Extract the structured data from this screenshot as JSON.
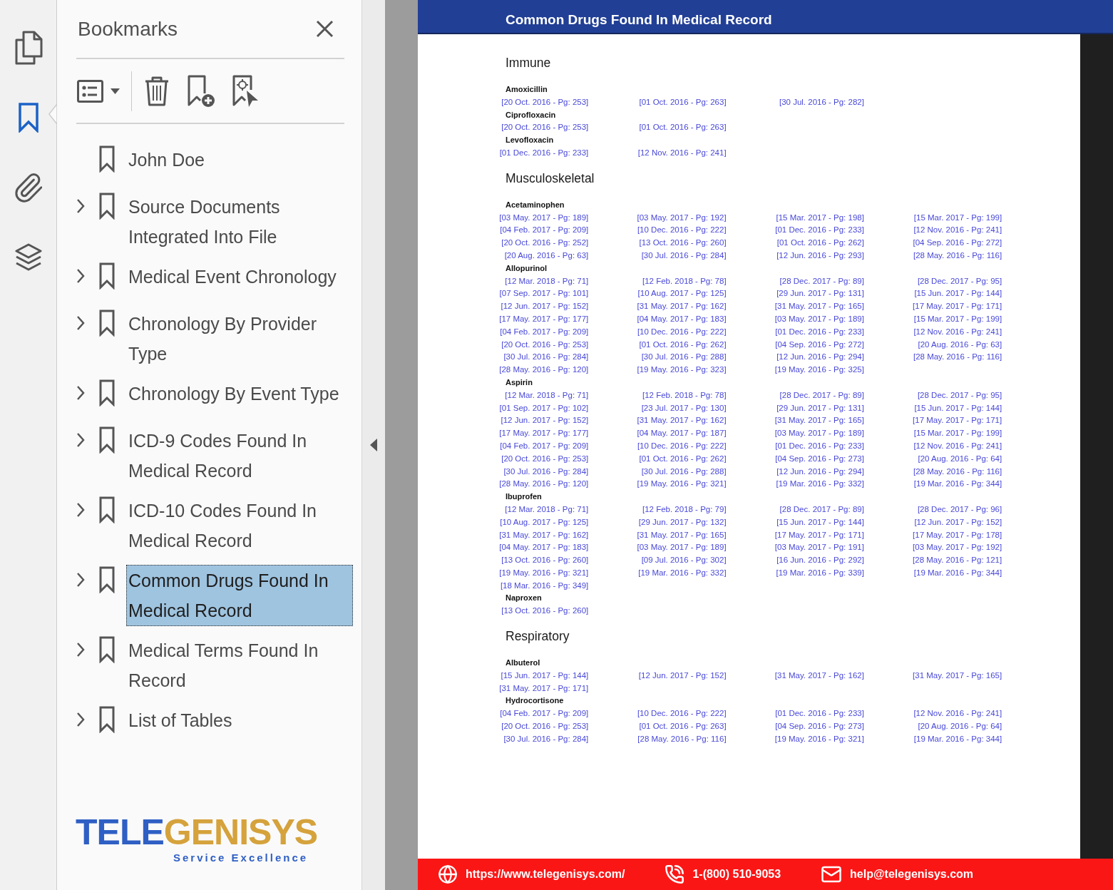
{
  "left_rail": {
    "items": [
      {
        "kind": "pages",
        "selected": false
      },
      {
        "kind": "bookmarks",
        "selected": true
      },
      {
        "kind": "attachments",
        "selected": false
      },
      {
        "kind": "layers",
        "selected": false
      }
    ]
  },
  "bookmarks_panel": {
    "title": "Bookmarks",
    "items": [
      {
        "label": "John Doe",
        "expandable": false,
        "selected": false
      },
      {
        "label": "Source Documents Integrated Into File",
        "expandable": true,
        "expanded": false,
        "selected": false
      },
      {
        "label": "Medical Event Chronology",
        "expandable": true,
        "expanded": false,
        "selected": false
      },
      {
        "label": "Chronology By Provider Type",
        "expandable": true,
        "expanded": false,
        "selected": false
      },
      {
        "label": "Chronology By Event Type",
        "expandable": true,
        "expanded": false,
        "selected": false
      },
      {
        "label": "ICD-9 Codes Found In Medical Record",
        "expandable": true,
        "expanded": false,
        "selected": false
      },
      {
        "label": "ICD-10 Codes Found In Medical Record",
        "expandable": true,
        "expanded": false,
        "selected": false
      },
      {
        "label": "Common Drugs Found In Medical Record",
        "expandable": true,
        "expanded": false,
        "selected": true
      },
      {
        "label": "Medical Terms Found In Record",
        "expandable": true,
        "expanded": false,
        "selected": false
      },
      {
        "label": "List of Tables",
        "expandable": true,
        "expanded": false,
        "selected": false
      }
    ]
  },
  "logo": {
    "wordmark_left": "TELE",
    "wordmark_right": "GENISYS",
    "tagline": "Service Excellence"
  },
  "document": {
    "title": "Common Drugs Found In Medical Record",
    "sections": [
      {
        "title": "Immune",
        "drugs": [
          {
            "name": "Amoxicillin",
            "references": [
              "[20 Oct. 2016 - Pg: 253]",
              "[01 Oct. 2016 - Pg: 263]",
              "[30 Jul. 2016 - Pg: 282]"
            ]
          },
          {
            "name": "Ciprofloxacin",
            "references": [
              "[20 Oct. 2016 - Pg: 253]",
              "[01 Oct. 2016 - Pg: 263]"
            ]
          },
          {
            "name": "Levofloxacin",
            "references": [
              "[01 Dec. 2016 - Pg: 233]",
              "[12 Nov. 2016 - Pg: 241]"
            ]
          }
        ]
      },
      {
        "title": "Musculoskeletal",
        "drugs": [
          {
            "name": "Acetaminophen",
            "references": [
              "[03 May. 2017 - Pg: 189]",
              "[03 May. 2017 - Pg: 192]",
              "[15 Mar. 2017 - Pg: 198]",
              "[15 Mar. 2017 - Pg: 199]",
              "[04 Feb. 2017 - Pg: 209]",
              "[10 Dec. 2016 - Pg: 222]",
              "[01 Dec. 2016 - Pg: 233]",
              "[12 Nov. 2016 - Pg: 241]",
              "[20 Oct. 2016 - Pg: 252]",
              "[13 Oct. 2016 - Pg: 260]",
              "[01 Oct. 2016 - Pg: 262]",
              "[04 Sep. 2016 - Pg: 272]",
              "[20 Aug. 2016 - Pg: 63]",
              "[30 Jul. 2016 - Pg: 284]",
              "[12 Jun. 2016 - Pg: 293]",
              "[28 May. 2016 - Pg: 116]"
            ]
          },
          {
            "name": "Allopurinol",
            "references": [
              "[12 Mar. 2018 - Pg: 71]",
              "[12 Feb. 2018 - Pg: 78]",
              "[28 Dec. 2017 - Pg: 89]",
              "[28 Dec. 2017 - Pg: 95]",
              "[07 Sep. 2017 - Pg: 101]",
              "[10 Aug. 2017 - Pg: 125]",
              "[29 Jun. 2017 - Pg: 131]",
              "[15 Jun. 2017 - Pg: 144]",
              "[12 Jun. 2017 - Pg: 152]",
              "[31 May. 2017 - Pg: 162]",
              "[31 May. 2017 - Pg: 165]",
              "[17 May. 2017 - Pg: 171]",
              "[17 May. 2017 - Pg: 177]",
              "[04 May. 2017 - Pg: 183]",
              "[03 May. 2017 - Pg: 189]",
              "[15 Mar. 2017 - Pg: 199]",
              "[04 Feb. 2017 - Pg: 209]",
              "[10 Dec. 2016 - Pg: 222]",
              "[01 Dec. 2016 - Pg: 233]",
              "[12 Nov. 2016 - Pg: 241]",
              "[20 Oct. 2016 - Pg: 253]",
              "[01 Oct. 2016 - Pg: 262]",
              "[04 Sep. 2016 - Pg: 272]",
              "[20 Aug. 2016 - Pg: 63]",
              "[30 Jul. 2016 - Pg: 284]",
              "[30 Jul. 2016 - Pg: 288]",
              "[12 Jun. 2016 - Pg: 294]",
              "[28 May. 2016 - Pg: 116]",
              "[28 May. 2016 - Pg: 120]",
              "[19 May. 2016 - Pg: 323]",
              "[19 May. 2016 - Pg: 325]"
            ]
          },
          {
            "name": "Aspirin",
            "references": [
              "[12 Mar. 2018 - Pg: 71]",
              "[12 Feb. 2018 - Pg: 78]",
              "[28 Dec. 2017 - Pg: 89]",
              "[28 Dec. 2017 - Pg: 95]",
              "[01 Sep. 2017 - Pg: 102]",
              "[23 Jul. 2017 - Pg: 130]",
              "[29 Jun. 2017 - Pg: 131]",
              "[15 Jun. 2017 - Pg: 144]",
              "[12 Jun. 2017 - Pg: 152]",
              "[31 May. 2017 - Pg: 162]",
              "[31 May. 2017 - Pg: 165]",
              "[17 May. 2017 - Pg: 171]",
              "[17 May. 2017 - Pg: 177]",
              "[04 May. 2017 - Pg: 187]",
              "[03 May. 2017 - Pg: 189]",
              "[15 Mar. 2017 - Pg: 199]",
              "[04 Feb. 2017 - Pg: 209]",
              "[10 Dec. 2016 - Pg: 222]",
              "[01 Dec. 2016 - Pg: 233]",
              "[12 Nov. 2016 - Pg: 241]",
              "[20 Oct. 2016 - Pg: 253]",
              "[01 Oct. 2016 - Pg: 262]",
              "[04 Sep. 2016 - Pg: 273]",
              "[20 Aug. 2016 - Pg: 64]",
              "[30 Jul. 2016 - Pg: 284]",
              "[30 Jul. 2016 - Pg: 288]",
              "[12 Jun. 2016 - Pg: 294]",
              "[28 May. 2016 - Pg: 116]",
              "[28 May. 2016 - Pg: 120]",
              "[19 May. 2016 - Pg: 321]",
              "[19 Mar. 2016 - Pg: 332]",
              "[19 Mar. 2016 - Pg: 344]"
            ]
          },
          {
            "name": "Ibuprofen",
            "references": [
              "[12 Mar. 2018 - Pg: 71]",
              "[12 Feb. 2018 - Pg: 79]",
              "[28 Dec. 2017 - Pg: 89]",
              "[28 Dec. 2017 - Pg: 96]",
              "[10 Aug. 2017 - Pg: 125]",
              "[29 Jun. 2017 - Pg: 132]",
              "[15 Jun. 2017 - Pg: 144]",
              "[12 Jun. 2017 - Pg: 152]",
              "[31 May. 2017 - Pg: 162]",
              "[31 May. 2017 - Pg: 165]",
              "[17 May. 2017 - Pg: 171]",
              "[17 May. 2017 - Pg: 178]",
              "[04 May. 2017 - Pg: 183]",
              "[03 May. 2017 - Pg: 189]",
              "[03 May. 2017 - Pg: 191]",
              "[03 May. 2017 - Pg: 192]",
              "[13 Oct. 2016 - Pg: 260]",
              "[09 Jul. 2016 - Pg: 302]",
              "[16 Jun. 2016 - Pg: 292]",
              "[28 May. 2016 - Pg: 121]",
              "[19 May. 2016 - Pg: 321]",
              "[19 Mar. 2016 - Pg: 332]",
              "[19 Mar. 2016 - Pg: 339]",
              "[19 Mar. 2016 - Pg: 344]",
              "[18 Mar. 2016 - Pg: 349]"
            ]
          },
          {
            "name": "Naproxen",
            "references": [
              "[13 Oct. 2016 - Pg: 260]"
            ]
          }
        ]
      },
      {
        "title": "Respiratory",
        "drugs": [
          {
            "name": "Albuterol",
            "references": [
              "[15 Jun. 2017 - Pg: 144]",
              "[12 Jun. 2017 - Pg: 152]",
              "[31 May. 2017 - Pg: 162]",
              "[31 May. 2017 - Pg: 165]",
              "[31 May. 2017 - Pg: 171]"
            ]
          },
          {
            "name": "Hydrocortisone",
            "references": [
              "[04 Feb. 2017 - Pg: 209]",
              "[10 Dec. 2016 - Pg: 222]",
              "[01 Dec. 2016 - Pg: 233]",
              "[12 Nov. 2016 - Pg: 241]",
              "[20 Oct. 2016 - Pg: 253]",
              "[01 Oct. 2016 - Pg: 263]",
              "[04 Sep. 2016 - Pg: 273]",
              "[20 Aug. 2016 - Pg: 64]",
              "[30 Jul. 2016 - Pg: 284]",
              "[28 May. 2016 - Pg: 116]",
              "[19 May. 2016 - Pg: 321]",
              "[19 Mar. 2016 - Pg: 344]"
            ]
          }
        ]
      }
    ]
  },
  "footer": {
    "website": "https://www.telegenisys.com/",
    "phone": "1-(800) 510-9053",
    "email": "help@telegenisys.com"
  }
}
